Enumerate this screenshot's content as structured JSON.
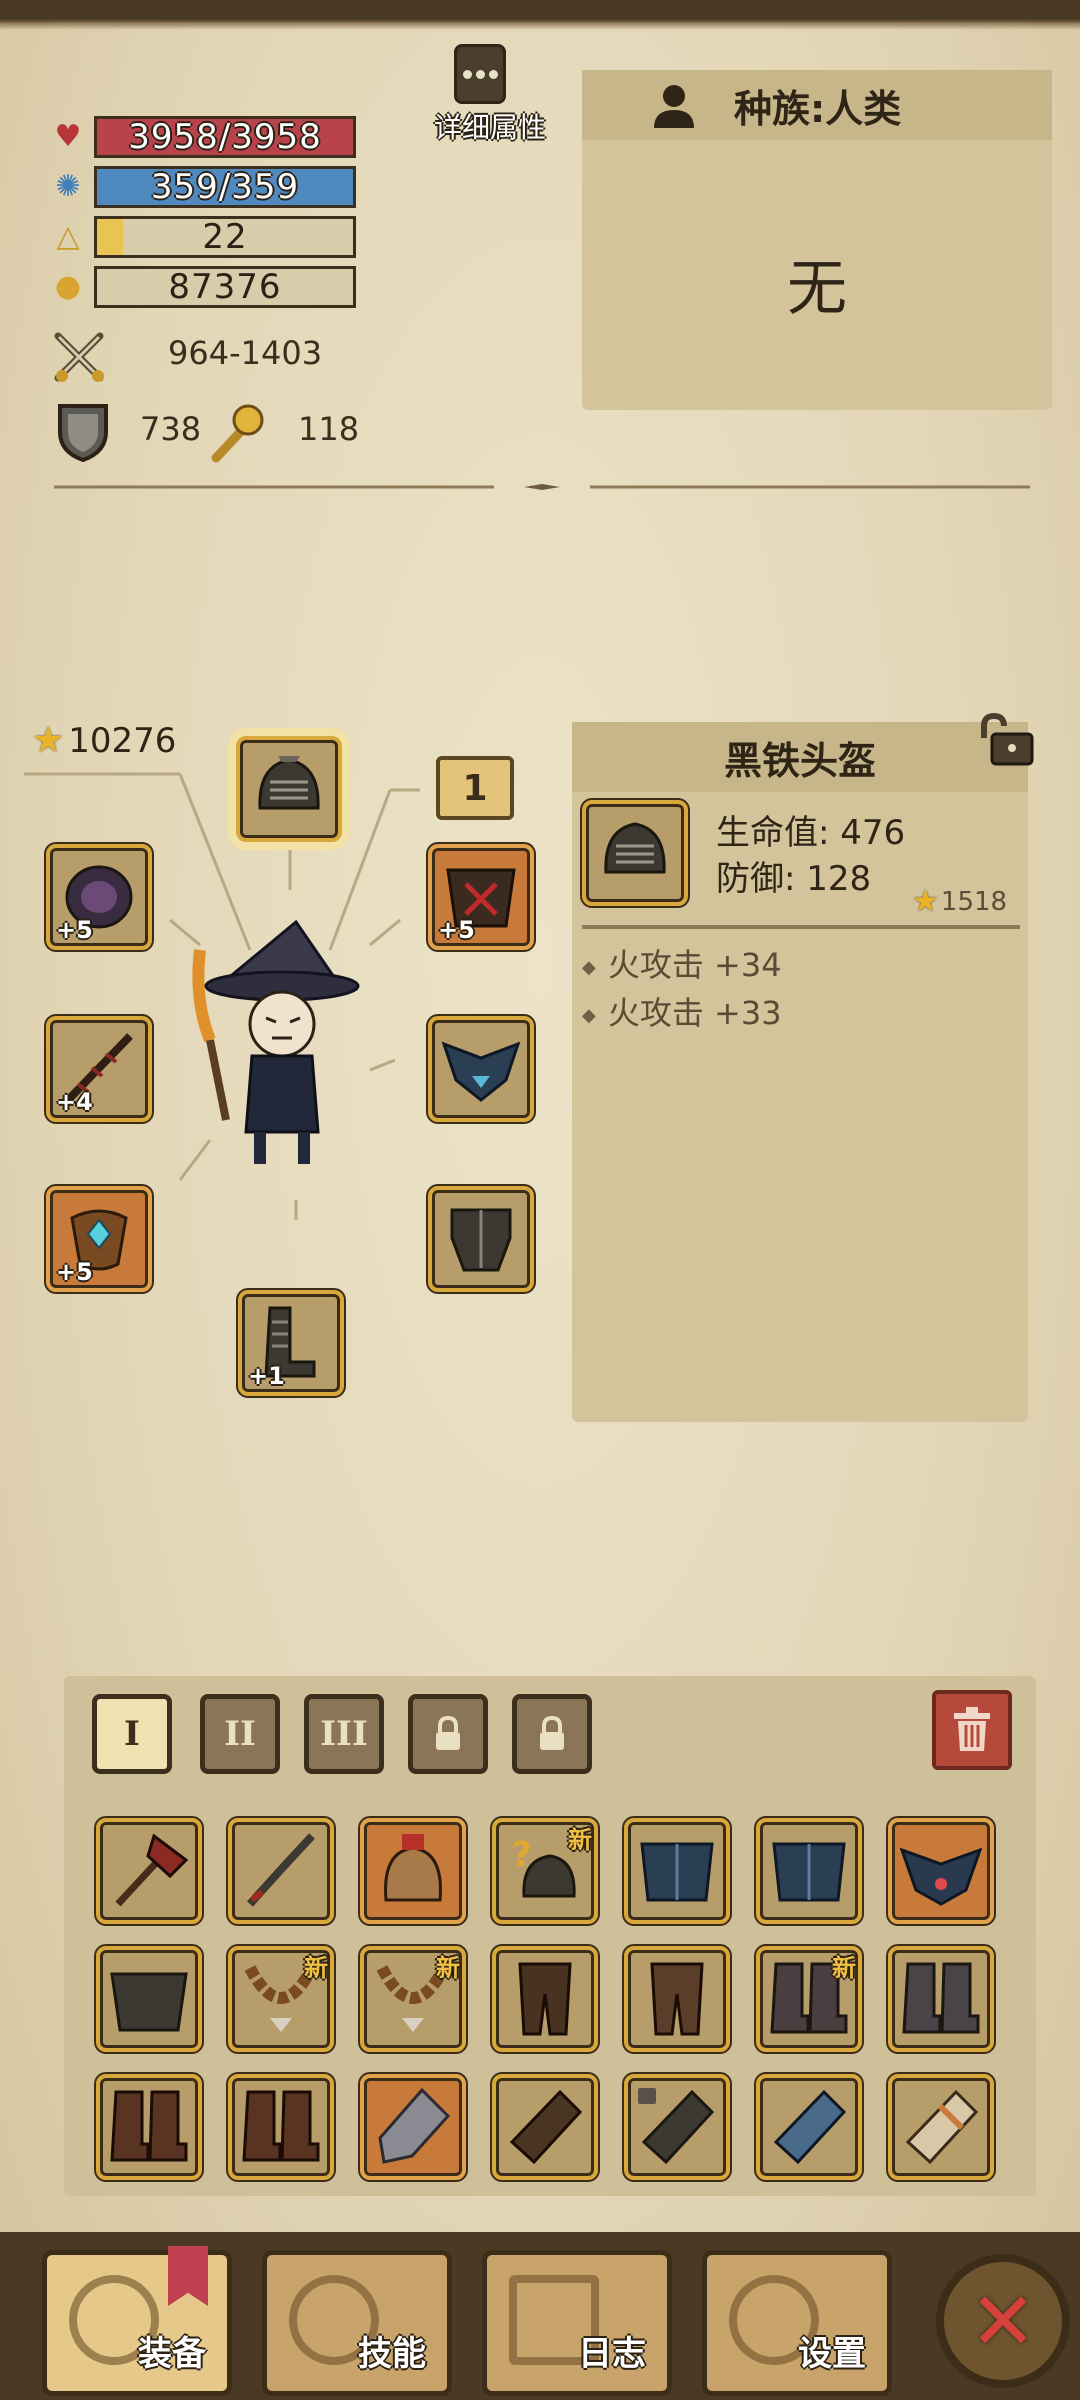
{
  "stats": {
    "hp": "3958/3958",
    "mp": "359/359",
    "level": "22",
    "gold": "87376",
    "attack": "964-1403",
    "defense": "738",
    "magic": "118",
    "hp_fill": 1.0,
    "mp_fill": 1.0,
    "exp_fill": 0.1
  },
  "detail_button": {
    "label": "详细属性"
  },
  "race": {
    "title": "种族:人类",
    "value": "无"
  },
  "equipment": {
    "power_score": "10276",
    "level_tag": "1",
    "slots": [
      {
        "name": "helmet",
        "plus": ""
      },
      {
        "name": "left-1",
        "plus": "+5"
      },
      {
        "name": "left-2",
        "plus": "+4"
      },
      {
        "name": "left-3",
        "plus": "+5"
      },
      {
        "name": "boots",
        "plus": "+1"
      },
      {
        "name": "right-1",
        "plus": "+5"
      },
      {
        "name": "right-2",
        "plus": ""
      },
      {
        "name": "right-3",
        "plus": ""
      }
    ]
  },
  "item_detail": {
    "name": "黑铁头盔",
    "stat1": "生命值: 476",
    "stat2": "防御: 128",
    "score": "1518",
    "affix1": "火攻击 +34",
    "affix2": "火攻击 +33"
  },
  "inventory": {
    "tabs": [
      "I",
      "II",
      "III"
    ],
    "new_label": "新"
  },
  "nav": {
    "equip": "装备",
    "skills": "技能",
    "log": "日志",
    "settings": "设置"
  }
}
